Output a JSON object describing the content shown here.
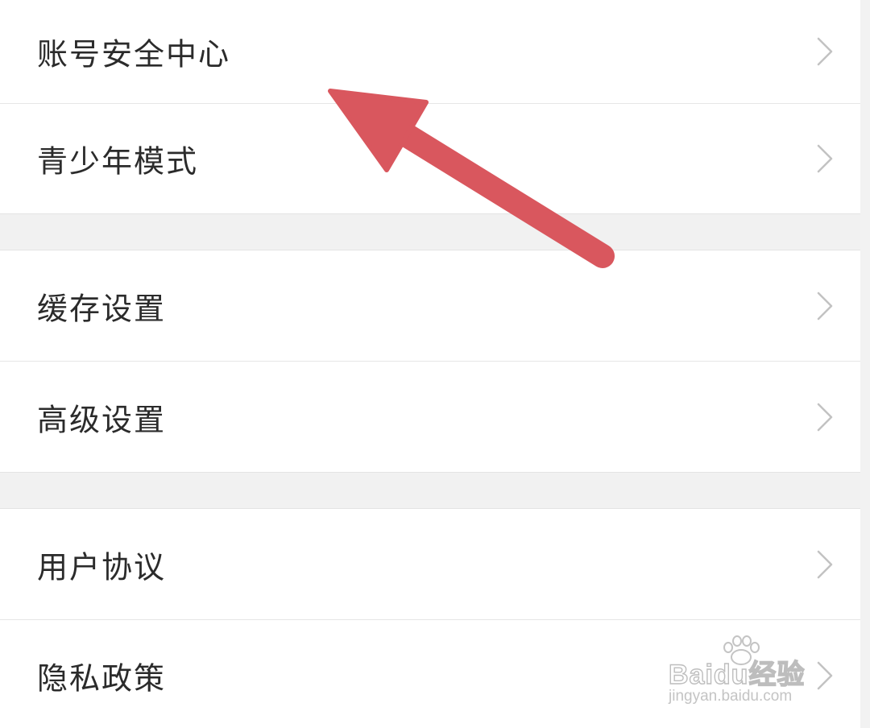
{
  "settings_list": {
    "groups": [
      {
        "items": [
          {
            "label": "账号安全中心",
            "icon": "chevron-right-icon"
          },
          {
            "label": "青少年模式",
            "icon": "chevron-right-icon"
          }
        ]
      },
      {
        "items": [
          {
            "label": "缓存设置",
            "icon": "chevron-right-icon"
          },
          {
            "label": "高级设置",
            "icon": "chevron-right-icon"
          }
        ]
      },
      {
        "items": [
          {
            "label": "用户协议",
            "icon": "chevron-right-icon"
          },
          {
            "label": "隐私政策",
            "icon": "chevron-right-icon"
          }
        ]
      }
    ]
  },
  "annotation": {
    "icon": "arrow-pointer-icon",
    "color": "#d9575e"
  },
  "watermark": {
    "brand": "Baidu经验",
    "url": "jingyan.baidu.com"
  },
  "colors": {
    "background": "#ffffff",
    "section_gap": "#f1f1f1",
    "divider": "#e6e6e6",
    "text": "#2b2b2b",
    "chevron": "#c2c2c2"
  }
}
